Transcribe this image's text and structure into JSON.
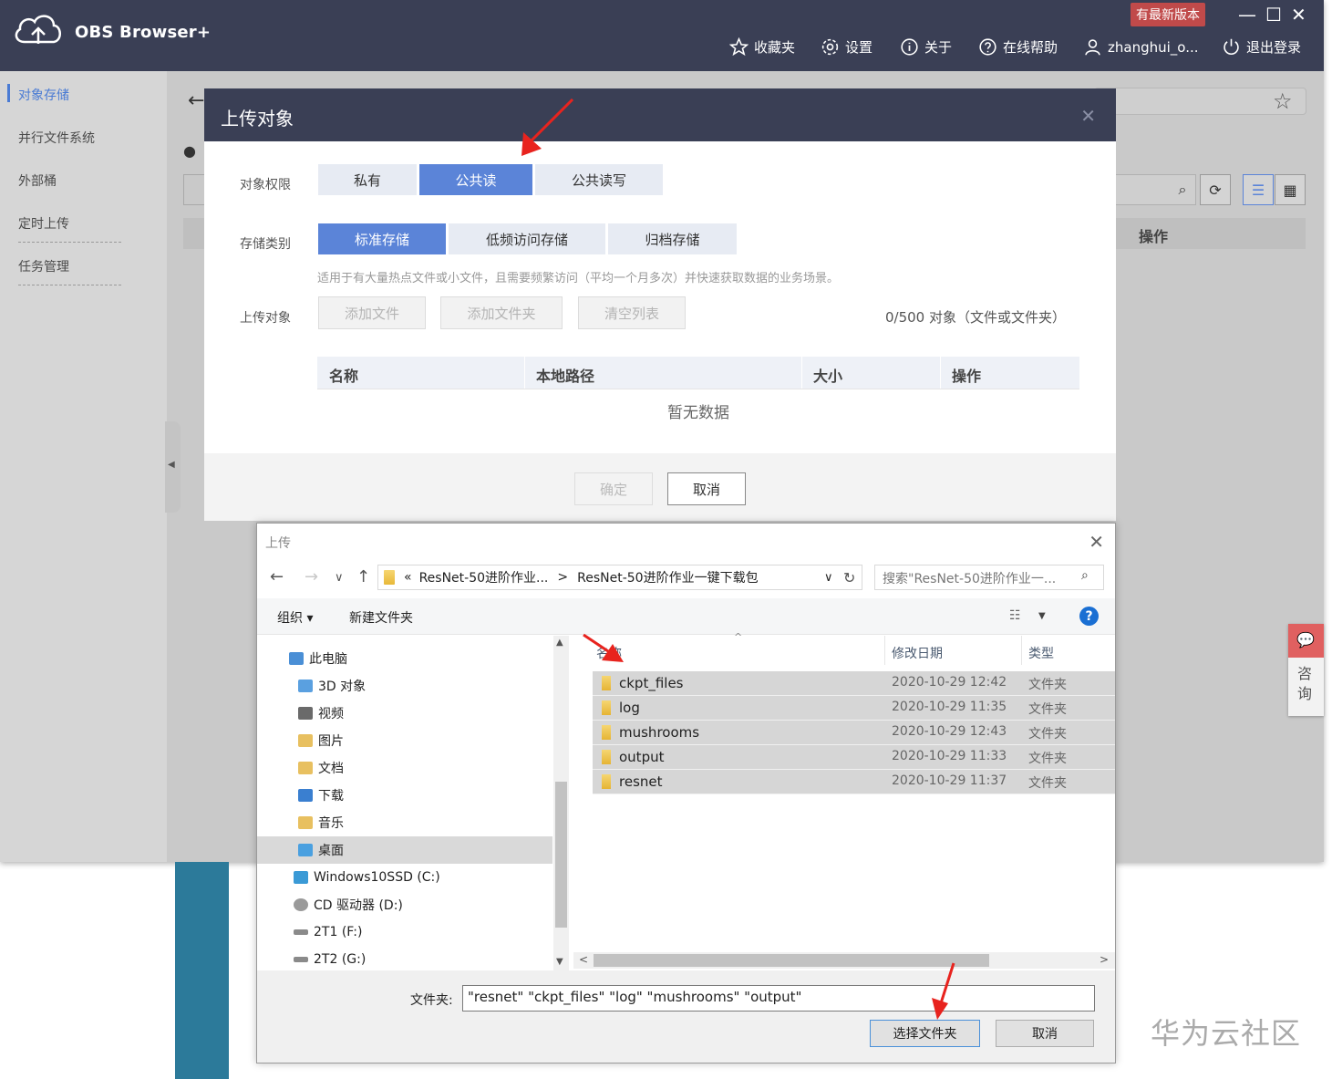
{
  "app": {
    "name": "OBS Browser+",
    "new_version_badge": "有最新版本",
    "nav": {
      "favorites": "收藏夹",
      "settings": "设置",
      "about": "关于",
      "help": "在线帮助",
      "user": "zhanghui_o...",
      "logout": "退出登录"
    },
    "sidebar": [
      "对象存储",
      "并行文件系统",
      "外部桶",
      "定时上传",
      "任务管理"
    ],
    "bg_table_ops": "操作",
    "colors": {
      "titlebar": "#3a3f55",
      "accent": "#5b84d8",
      "badge": "#c04a4a"
    }
  },
  "modal": {
    "title": "上传对象",
    "permission_label": "对象权限",
    "permission_options": [
      "私有",
      "公共读",
      "公共读写"
    ],
    "permission_selected": "公共读",
    "storage_label": "存储类别",
    "storage_options": [
      "标准存储",
      "低频访问存储",
      "归档存储"
    ],
    "storage_selected": "标准存储",
    "storage_hint": "适用于有大量热点文件或小文件，且需要频繁访问（平均一个月多次）并快速获取数据的业务场景。",
    "upload_label": "上传对象",
    "buttons": {
      "add_file": "添加文件",
      "add_folder": "添加文件夹",
      "clear_list": "清空列表",
      "confirm": "确定",
      "cancel": "取消"
    },
    "count_text": "0/500 对象（文件或文件夹）",
    "table_headers": [
      "名称",
      "本地路径",
      "大小",
      "操作"
    ],
    "empty_text": "暂无数据"
  },
  "dialog": {
    "title": "上传",
    "breadcrumb_root": "«",
    "breadcrumb_1": "ResNet-50进阶作业...",
    "breadcrumb_sep": ">",
    "breadcrumb_2": "ResNet-50进阶作业一键下载包",
    "search_placeholder": "搜索\"ResNet-50进阶作业一...",
    "organize": "组织 ▾",
    "new_folder": "新建文件夹",
    "tree": [
      {
        "label": "此电脑",
        "icon": "pc-icon",
        "color": "#4a8fd6",
        "indent": 1
      },
      {
        "label": "3D 对象",
        "icon": "3d-objects-icon",
        "color": "#5aa0e0",
        "indent": 2
      },
      {
        "label": "视频",
        "icon": "video-folder-icon",
        "color": "#6a6a6a",
        "indent": 2
      },
      {
        "label": "图片",
        "icon": "pictures-folder-icon",
        "color": "#e8c060",
        "indent": 2
      },
      {
        "label": "文档",
        "icon": "documents-folder-icon",
        "color": "#e8c060",
        "indent": 2
      },
      {
        "label": "下载",
        "icon": "downloads-folder-icon",
        "color": "#3a7fd0",
        "indent": 2
      },
      {
        "label": "音乐",
        "icon": "music-folder-icon",
        "color": "#e8c060",
        "indent": 2
      },
      {
        "label": "桌面",
        "icon": "desktop-folder-icon",
        "color": "#4aa0e0",
        "indent": 2,
        "selected": true
      },
      {
        "label": "Windows10SSD (C:)",
        "icon": "drive-c-icon",
        "color": "#3a9ad6",
        "indent": 2
      },
      {
        "label": "CD 驱动器 (D:)",
        "icon": "cd-drive-icon",
        "color": "#9a9a9a",
        "indent": 2
      },
      {
        "label": "2T1 (F:)",
        "icon": "drive-f-icon",
        "color": "#8a8a8a",
        "indent": 2
      },
      {
        "label": "2T2 (G:)",
        "icon": "drive-g-icon",
        "color": "#8a8a8a",
        "indent": 2
      }
    ],
    "columns": [
      "名称",
      "修改日期",
      "类型"
    ],
    "files": [
      {
        "name": "ckpt_files",
        "date": "2020-10-29 12:42",
        "type": "文件夹"
      },
      {
        "name": "log",
        "date": "2020-10-29 11:35",
        "type": "文件夹"
      },
      {
        "name": "mushrooms",
        "date": "2020-10-29 12:43",
        "type": "文件夹"
      },
      {
        "name": "output",
        "date": "2020-10-29 11:33",
        "type": "文件夹"
      },
      {
        "name": "resnet",
        "date": "2020-10-29 11:37",
        "type": "文件夹"
      }
    ],
    "folder_label": "文件夹:",
    "folder_value": "\"resnet\" \"ckpt_files\" \"log\" \"mushrooms\" \"output\"",
    "select_button": "选择文件夹",
    "cancel_button": "取消"
  },
  "consult": {
    "text": "咨询"
  },
  "watermark": "华为云社区"
}
